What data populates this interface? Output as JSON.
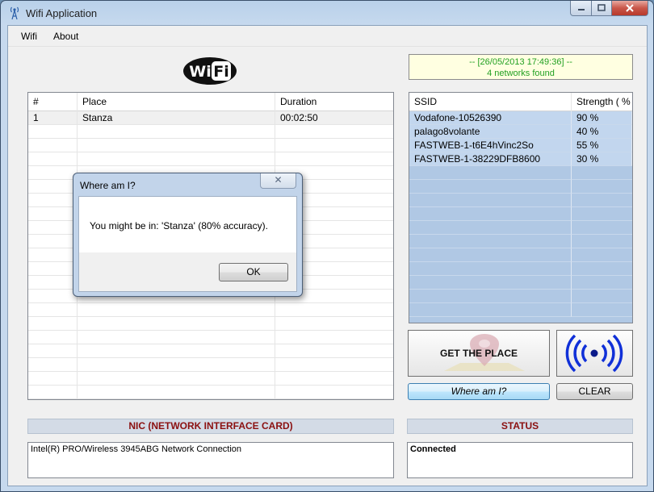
{
  "window": {
    "title": "Wifi Application"
  },
  "menu": {
    "items": [
      "Wifi",
      "About"
    ]
  },
  "logo": {
    "text": "WiFi"
  },
  "info": {
    "timestamp": "-- [26/05/2013 17:49:36] --",
    "networks_found": "4 networks found"
  },
  "places": {
    "columns": [
      "#",
      "Place",
      "Duration"
    ],
    "rows": [
      {
        "num": "1",
        "place": "Stanza",
        "duration": "00:02:50"
      }
    ]
  },
  "networks": {
    "columns": [
      "SSID",
      "Strength ( % )"
    ],
    "rows": [
      {
        "ssid": "Vodafone-10526390",
        "strength": "90 %"
      },
      {
        "ssid": "palago8volante",
        "strength": "40 %"
      },
      {
        "ssid": "FASTWEB-1-t6E4hVinc2So",
        "strength": "55 %"
      },
      {
        "ssid": "FASTWEB-1-38229DFB8600",
        "strength": "30 %"
      }
    ]
  },
  "buttons": {
    "get_place": "GET THE PLACE",
    "where_am_i": "Where am I?",
    "clear": "CLEAR"
  },
  "nic": {
    "header": "NIC (NETWORK INTERFACE CARD)",
    "value": "Intel(R) PRO/Wireless 3945ABG Network Connection"
  },
  "status": {
    "header": "STATUS",
    "value": "Connected"
  },
  "dialog": {
    "title": "Where am I?",
    "message": "You might be in: 'Stanza' (80% accuracy).",
    "ok": "OK"
  },
  "colors": {
    "accent_green": "#22a022",
    "header_red": "#8b1010",
    "grid_blue": "#b0c8e4"
  }
}
